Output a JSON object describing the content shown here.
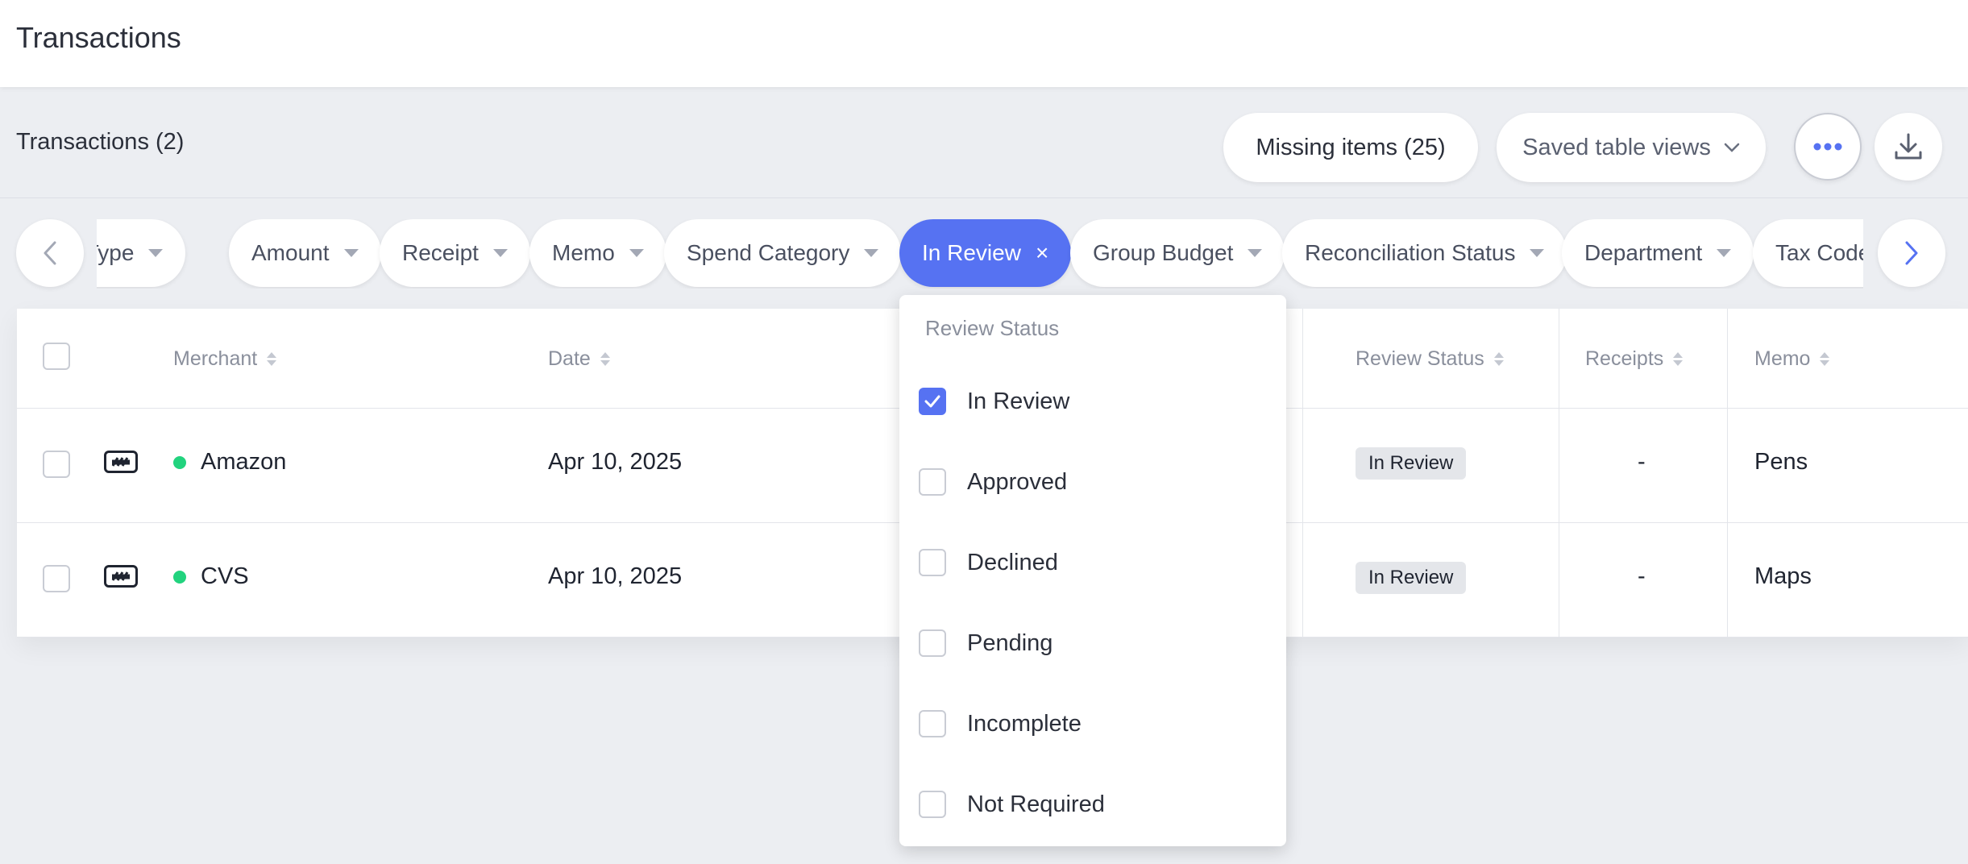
{
  "header": {
    "title": "Transactions"
  },
  "toolbar": {
    "count_label": "Transactions (2)",
    "missing_items_label": "Missing items (25)",
    "saved_views_label": "Saved table views"
  },
  "filters": {
    "chips": [
      {
        "label": "ard Type"
      },
      {
        "label": "Amount"
      },
      {
        "label": "Receipt"
      },
      {
        "label": "Memo"
      },
      {
        "label": "Spend Category"
      },
      {
        "label": "In Review",
        "active": true
      },
      {
        "label": "Group Budget"
      },
      {
        "label": "Reconciliation Status"
      },
      {
        "label": "Department"
      },
      {
        "label": "Tax Code"
      }
    ]
  },
  "table": {
    "columns": [
      "Merchant",
      "Date",
      "Review Status",
      "Receipts",
      "Memo"
    ],
    "rows": [
      {
        "merchant": "Amazon",
        "date": "Apr 10, 2025",
        "review_status": "In Review",
        "receipts": "-",
        "memo": "Pens"
      },
      {
        "merchant": "CVS",
        "date": "Apr 10, 2025",
        "review_status": "In Review",
        "receipts": "-",
        "memo": "Maps"
      }
    ]
  },
  "review_dropdown": {
    "title": "Review Status",
    "options": [
      {
        "label": "In Review",
        "checked": true
      },
      {
        "label": "Approved",
        "checked": false
      },
      {
        "label": "Declined",
        "checked": false
      },
      {
        "label": "Pending",
        "checked": false
      },
      {
        "label": "Incomplete",
        "checked": false
      },
      {
        "label": "Not Required",
        "checked": false
      }
    ]
  },
  "colors": {
    "accent": "#5672f2",
    "status_dot": "#22d37e",
    "background": "#eceef2"
  }
}
